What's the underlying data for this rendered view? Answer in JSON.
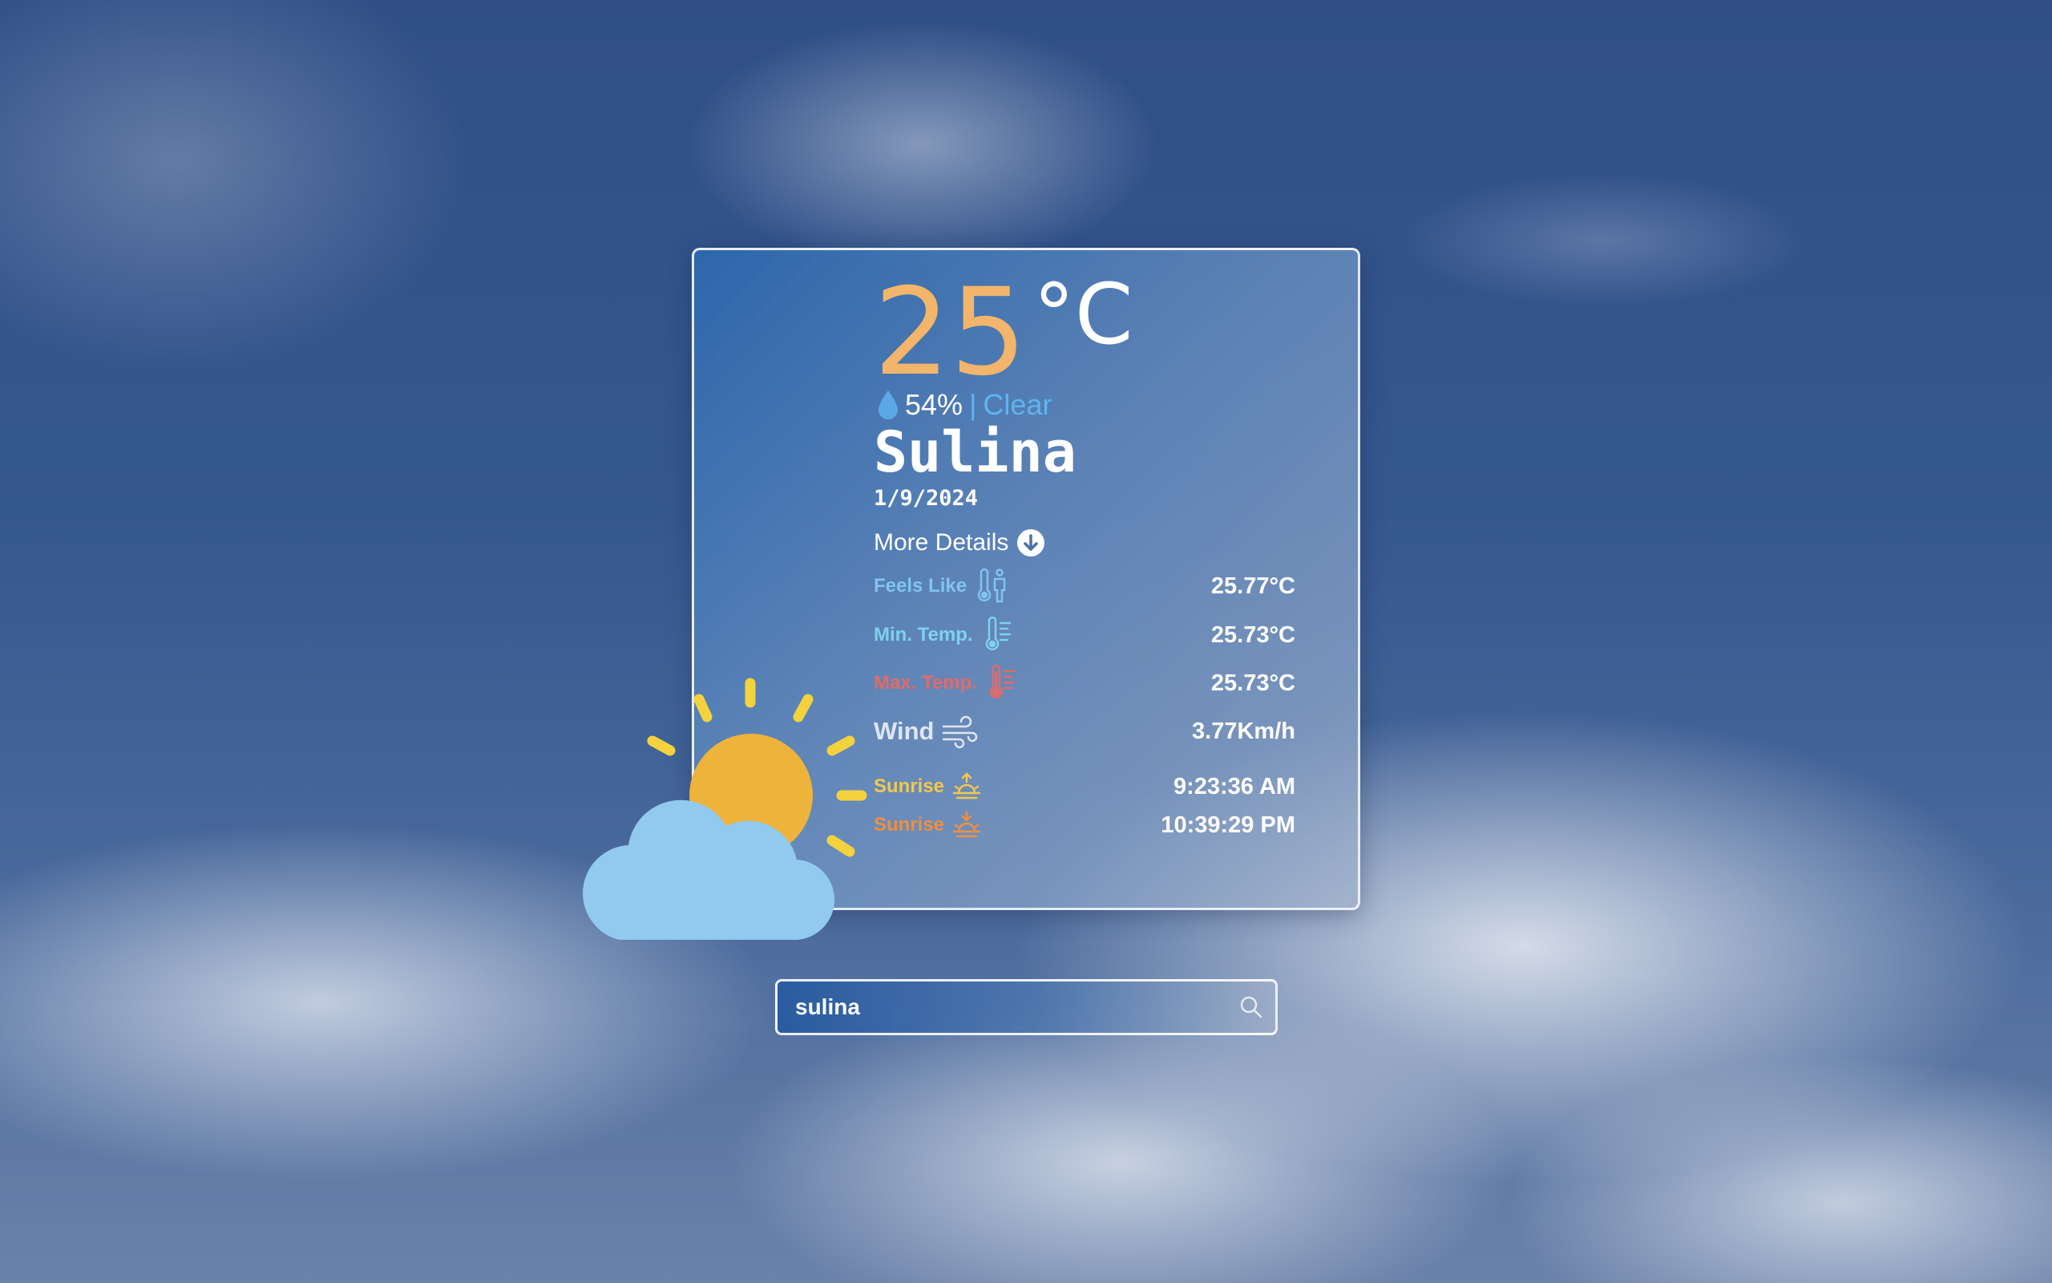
{
  "weather": {
    "temperature": "25",
    "unit": "°C",
    "humidity": "54%",
    "separator": "|",
    "condition": "Clear",
    "city": "Sulina",
    "date": "1/9/2024",
    "more_details_label": "More Details"
  },
  "details": {
    "feels_like": {
      "label": "Feels Like",
      "value": "25.77°C",
      "icon": "thermometer-person-icon"
    },
    "min_temp": {
      "label": "Min. Temp.",
      "value": "25.73°C",
      "icon": "thermometer-low-icon"
    },
    "max_temp": {
      "label": "Max. Temp.",
      "value": "25.73°C",
      "icon": "thermometer-high-icon"
    },
    "wind": {
      "label": "Wind",
      "value": "3.77Km/h",
      "icon": "wind-icon"
    },
    "sunrise": {
      "label": "Sunrise",
      "value": "9:23:36 AM",
      "icon": "sunrise-icon"
    },
    "sunset": {
      "label": "Sunrise",
      "value": "10:39:29 PM",
      "icon": "sunset-icon"
    }
  },
  "search": {
    "value": "sulina",
    "icon": "search-icon"
  },
  "colors": {
    "temp_accent": "#f2b56b",
    "condition": "#60b4ee",
    "sun": "#eeb33b",
    "cloud": "#91c9ef"
  }
}
